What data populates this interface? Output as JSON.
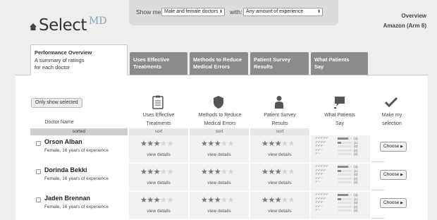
{
  "brand": {
    "name": "Select",
    "suffix": "MD"
  },
  "filters": {
    "show_me_label": "Show me:",
    "show_me_value": "Male and female doctors",
    "with_label": "with:",
    "with_value": "Any amount of experience"
  },
  "top_right": {
    "link": "Overview",
    "subtitle": "Amazon (Arm 6)"
  },
  "tabs": [
    {
      "title": "Performance Overview",
      "desc": "A summary of ratings for each doctor",
      "active": true
    },
    {
      "title": "Uses Effective Treatments"
    },
    {
      "title": "Methods to Reduce Medical Errors"
    },
    {
      "title": "Patient Survey Results"
    },
    {
      "title": "What Patients Say"
    }
  ],
  "only_show_selected": "Only show selected",
  "columns": {
    "doctor": "Doctor Name",
    "treatments": "Uses Effective Treatments",
    "errors": "Methods to Reduce Medical Errors",
    "survey": "Patient Survey Results",
    "say": "What Patients Say",
    "selection": "Make my selection"
  },
  "sort": {
    "sorted": "sorted",
    "sort": "sort"
  },
  "doctors": [
    {
      "name": "Orson Alban",
      "desc": "Female, 16 years of experience",
      "ratings": [
        3,
        3,
        3
      ],
      "view": "view details",
      "choose": "Choose"
    },
    {
      "name": "Dorinda Bekki",
      "desc": "Female, 16 years of experience",
      "ratings": [
        3,
        3,
        3
      ],
      "view": "view details",
      "choose": "Choose"
    },
    {
      "name": "Jaden Brennan",
      "desc": "Female, 16 years of experience",
      "ratings": [
        3,
        3,
        3
      ],
      "view": "view details",
      "choose": "Choose"
    }
  ],
  "review_summary": {
    "counts": [
      "(3)",
      "(1)",
      "(0)",
      "(0)",
      "(0)"
    ],
    "bar_fractions": [
      0.75,
      0.25,
      0.0,
      0.0,
      0.0
    ]
  },
  "icons": {
    "home": "home-icon",
    "treatments": "clipboard-icon",
    "errors": "shield-icon",
    "survey": "person-icon",
    "say": "speech-bubble-icon",
    "selection": "checkmark-icon"
  }
}
